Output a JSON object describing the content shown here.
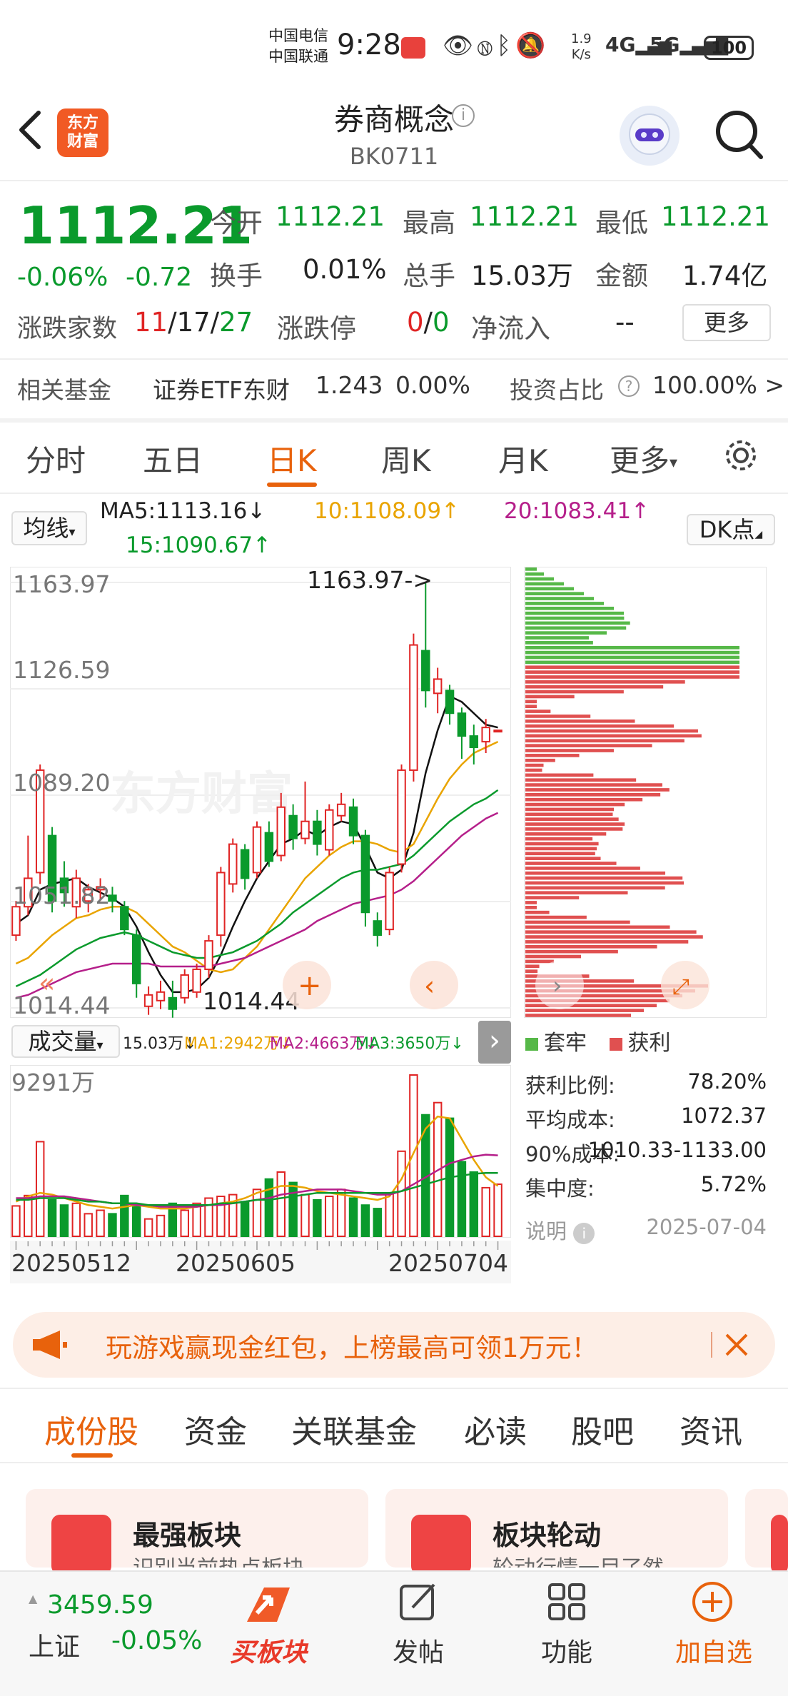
{
  "status_bar": {
    "carrier1": "中国电信",
    "carrier2": "中国联通",
    "time": "9:28",
    "speed_value": "1.9",
    "speed_unit": "K/s",
    "net1": "4G",
    "net2": "5G",
    "battery": "100"
  },
  "header": {
    "logo_line1": "东方",
    "logo_line2": "财富",
    "title": "券商概念",
    "code": "BK0711"
  },
  "quote": {
    "price": "1112.21",
    "change_pct": "-0.06%",
    "change": "-0.72",
    "open_label": "今开",
    "open": "1112.21",
    "high_label": "最高",
    "high": "1112.21",
    "low_label": "最低",
    "low": "1112.21",
    "turnover_label": "换手",
    "turnover": "0.01%",
    "volume_label": "总手",
    "volume": "15.03万",
    "amount_label": "金额",
    "amount": "1.74亿",
    "updown_label": "涨跌家数",
    "up": "11",
    "sep1": "/",
    "flat": "17",
    "sep2": "/",
    "down": "27",
    "limit_label": "涨跌停",
    "limit_up": "0",
    "sep3": "/",
    "limit_down": "0",
    "netflow_label": "净流入",
    "netflow": "--",
    "more_label": "更多"
  },
  "fund": {
    "label": "相关基金",
    "name": "证券ETF东财",
    "price": "1.243",
    "pct": "0.00%",
    "ratio_label": "投资占比",
    "ratio": "100.00% >"
  },
  "period_tabs": [
    "分时",
    "五日",
    "日K",
    "周K",
    "月K",
    "更多"
  ],
  "ma": {
    "selector": "均线",
    "ma5": "MA5:1113.16↓",
    "ma10": "10:1108.09↑",
    "ma20": "20:1083.41↑",
    "ma15": "15:1090.67↑",
    "dk": "DK点"
  },
  "chart_labels": {
    "y1": "1163.97",
    "y2": "1126.59",
    "y3": "1089.20",
    "y4": "1051.82",
    "y5": "1014.44",
    "max_annot": "1163.97->",
    "min_annot": "1014.44",
    "watermark": "东方财富"
  },
  "volume_row": {
    "selector": "成交量",
    "vol": "15.03万↓",
    "ma1": "MA1:2942万↓",
    "ma2": "MA2:4663万↓",
    "ma3": "MA3:3650万↓",
    "max": "9291万"
  },
  "dates": [
    "20250512",
    "20250605",
    "20250704"
  ],
  "profile_legend": {
    "trapped": "套牢",
    "profit": "获利"
  },
  "profile_stats": [
    {
      "label": "获利比例:",
      "value": "78.20%"
    },
    {
      "label": "平均成本:",
      "value": "1072.37"
    },
    {
      "label": "90%成本:",
      "value": "1010.33-1133.00"
    },
    {
      "label": "集中度:",
      "value": "5.72%"
    }
  ],
  "profile_note": {
    "label": "说明",
    "date": "2025-07-04"
  },
  "promo": {
    "text": "玩游戏赢现金红包，上榜最高可领1万元！"
  },
  "sub_tabs": [
    "成份股",
    "资金",
    "关联基金",
    "必读",
    "股吧",
    "资讯"
  ],
  "cards": [
    {
      "title": "最强板块",
      "sub": "识别当前热点板块"
    },
    {
      "title": "板块轮动",
      "sub": "轮动行情一目了然"
    }
  ],
  "bottom_nav": {
    "index_value": "3459.59",
    "index_name": "上证",
    "index_pct": "-0.05%",
    "buy": "买板块",
    "post": "发帖",
    "func": "功能",
    "add": "加自选"
  },
  "colors": {
    "up": "#e02424",
    "down": "#0a9a2c",
    "accent": "#e8620c"
  },
  "chart_data": {
    "type": "candlestick",
    "ylim": [
      1014.44,
      1163.97
    ],
    "candles": [
      {
        "o": 1040,
        "c": 1050,
        "h": 1052,
        "l": 1038
      },
      {
        "o": 1050,
        "c": 1060,
        "h": 1075,
        "l": 1047
      },
      {
        "o": 1062,
        "c": 1098,
        "h": 1100,
        "l": 1058
      },
      {
        "o": 1075,
        "c": 1052,
        "h": 1078,
        "l": 1048
      },
      {
        "o": 1060,
        "c": 1055,
        "h": 1066,
        "l": 1050
      },
      {
        "o": 1050,
        "c": 1060,
        "h": 1063,
        "l": 1046
      },
      {
        "o": 1052,
        "c": 1056,
        "h": 1058,
        "l": 1048
      },
      {
        "o": 1056,
        "c": 1057,
        "h": 1060,
        "l": 1052
      },
      {
        "o": 1054,
        "c": 1052,
        "h": 1057,
        "l": 1048
      },
      {
        "o": 1050,
        "c": 1042,
        "h": 1052,
        "l": 1040
      },
      {
        "o": 1040,
        "c": 1023,
        "h": 1042,
        "l": 1018
      },
      {
        "o": 1015,
        "c": 1019,
        "h": 1022,
        "l": 1012
      },
      {
        "o": 1017,
        "c": 1020,
        "h": 1024,
        "l": 1014
      },
      {
        "o": 1018,
        "c": 1014,
        "h": 1024,
        "l": 1011
      },
      {
        "o": 1018,
        "c": 1026,
        "h": 1028,
        "l": 1016
      },
      {
        "o": 1020,
        "c": 1028,
        "h": 1030,
        "l": 1018
      },
      {
        "o": 1028,
        "c": 1038,
        "h": 1040,
        "l": 1025
      },
      {
        "o": 1040,
        "c": 1062,
        "h": 1064,
        "l": 1036
      },
      {
        "o": 1058,
        "c": 1072,
        "h": 1074,
        "l": 1055
      },
      {
        "o": 1070,
        "c": 1060,
        "h": 1072,
        "l": 1056
      },
      {
        "o": 1062,
        "c": 1078,
        "h": 1080,
        "l": 1060
      },
      {
        "o": 1076,
        "c": 1066,
        "h": 1080,
        "l": 1064
      },
      {
        "o": 1068,
        "c": 1085,
        "h": 1090,
        "l": 1066
      },
      {
        "o": 1082,
        "c": 1074,
        "h": 1086,
        "l": 1070
      },
      {
        "o": 1074,
        "c": 1080,
        "h": 1094,
        "l": 1072
      },
      {
        "o": 1080,
        "c": 1072,
        "h": 1084,
        "l": 1068
      },
      {
        "o": 1070,
        "c": 1084,
        "h": 1086,
        "l": 1068
      },
      {
        "o": 1082,
        "c": 1086,
        "h": 1090,
        "l": 1080
      },
      {
        "o": 1085,
        "c": 1075,
        "h": 1088,
        "l": 1072
      },
      {
        "o": 1075,
        "c": 1048,
        "h": 1077,
        "l": 1043
      },
      {
        "o": 1045,
        "c": 1040,
        "h": 1048,
        "l": 1036
      },
      {
        "o": 1042,
        "c": 1062,
        "h": 1064,
        "l": 1040
      },
      {
        "o": 1065,
        "c": 1098,
        "h": 1100,
        "l": 1062
      },
      {
        "o": 1098,
        "c": 1142,
        "h": 1146,
        "l": 1094
      },
      {
        "o": 1140,
        "c": 1126,
        "h": 1164,
        "l": 1120
      },
      {
        "o": 1125,
        "c": 1130,
        "h": 1134,
        "l": 1118
      },
      {
        "o": 1126,
        "c": 1118,
        "h": 1128,
        "l": 1114
      },
      {
        "o": 1118,
        "c": 1110,
        "h": 1120,
        "l": 1102
      },
      {
        "o": 1110,
        "c": 1106,
        "h": 1114,
        "l": 1100
      },
      {
        "o": 1108,
        "c": 1113,
        "h": 1116,
        "l": 1104
      },
      {
        "o": 1112,
        "c": 1112,
        "h": 1112,
        "l": 1112
      }
    ],
    "volumes": [
      1750,
      2350,
      5450,
      2100,
      1800,
      1900,
      1300,
      1500,
      1300,
      2350,
      1700,
      1000,
      1200,
      1900,
      1500,
      1900,
      2200,
      2300,
      2400,
      2000,
      2700,
      3300,
      3700,
      3100,
      2400,
      2100,
      2300,
      2700,
      2200,
      1800,
      1600,
      2500,
      4900,
      9291,
      7000,
      7700,
      6800,
      4300,
      3700,
      2800,
      3000
    ],
    "ma_lines": {
      "ma5": [
        1044,
        1047,
        1056,
        1058,
        1059,
        1060,
        1057,
        1055,
        1053,
        1050,
        1043,
        1034,
        1026,
        1020,
        1020,
        1021,
        1025,
        1033,
        1043,
        1052,
        1060,
        1066,
        1072,
        1074,
        1077,
        1075,
        1078,
        1080,
        1079,
        1071,
        1062,
        1060,
        1063,
        1076,
        1097,
        1112,
        1124,
        1122,
        1118,
        1114,
        1113
      ],
      "ma10": [
        1030,
        1032,
        1036,
        1040,
        1043,
        1046,
        1047,
        1049,
        1050,
        1050,
        1048,
        1044,
        1040,
        1036,
        1034,
        1031,
        1028,
        1027,
        1028,
        1032,
        1036,
        1042,
        1048,
        1054,
        1060,
        1064,
        1068,
        1071,
        1073,
        1073,
        1072,
        1070,
        1069,
        1072,
        1080,
        1088,
        1095,
        1100,
        1104,
        1106,
        1108
      ],
      "ma15": [
        1022,
        1024,
        1026,
        1029,
        1032,
        1035,
        1037,
        1039,
        1040,
        1041,
        1040,
        1038,
        1036,
        1034,
        1033,
        1032,
        1032,
        1033,
        1034,
        1036,
        1038,
        1041,
        1044,
        1048,
        1051,
        1054,
        1057,
        1060,
        1062,
        1063,
        1063,
        1064,
        1065,
        1068,
        1072,
        1076,
        1080,
        1083,
        1086,
        1088,
        1091
      ],
      "ma20": [
        1018,
        1019,
        1021,
        1023,
        1025,
        1027,
        1028,
        1029,
        1030,
        1030,
        1030,
        1030,
        1029,
        1029,
        1029,
        1029,
        1029,
        1030,
        1031,
        1032,
        1034,
        1036,
        1038,
        1040,
        1042,
        1045,
        1047,
        1049,
        1051,
        1052,
        1053,
        1054,
        1056,
        1059,
        1063,
        1067,
        1071,
        1075,
        1078,
        1081,
        1083
      ]
    },
    "vol_ma": {
      "ma1": [
        2000,
        2300,
        2500,
        2400,
        2200,
        2000,
        1800,
        1700,
        1600,
        1700,
        1800,
        1700,
        1600,
        1600,
        1600,
        1700,
        1800,
        1900,
        2000,
        2200,
        2500,
        2700,
        2900,
        2900,
        2800,
        2600,
        2500,
        2400,
        2300,
        2200,
        2100,
        2300,
        3300,
        4800,
        6200,
        6900,
        6800,
        5600,
        4400,
        3400,
        2900
      ],
      "ma2": [
        2200,
        2200,
        2300,
        2300,
        2300,
        2200,
        2100,
        2000,
        1900,
        1900,
        1800,
        1800,
        1700,
        1700,
        1700,
        1700,
        1800,
        1800,
        1900,
        2000,
        2100,
        2200,
        2400,
        2500,
        2600,
        2700,
        2700,
        2700,
        2600,
        2500,
        2400,
        2400,
        2600,
        3000,
        3400,
        3800,
        4200,
        4400,
        4600,
        4700,
        4663
      ],
      "ma3": [
        2100,
        2100,
        2200,
        2200,
        2200,
        2100,
        2000,
        2000,
        1900,
        1900,
        1900,
        1800,
        1800,
        1800,
        1800,
        1800,
        1800,
        1900,
        1900,
        2000,
        2100,
        2100,
        2200,
        2300,
        2400,
        2500,
        2500,
        2500,
        2500,
        2500,
        2500,
        2500,
        2600,
        2800,
        3000,
        3200,
        3400,
        3500,
        3600,
        3650,
        3650
      ]
    },
    "vol_ylim": [
      0,
      9291
    ],
    "profile_rows": 92,
    "profile_profit_fraction": 0.782
  }
}
